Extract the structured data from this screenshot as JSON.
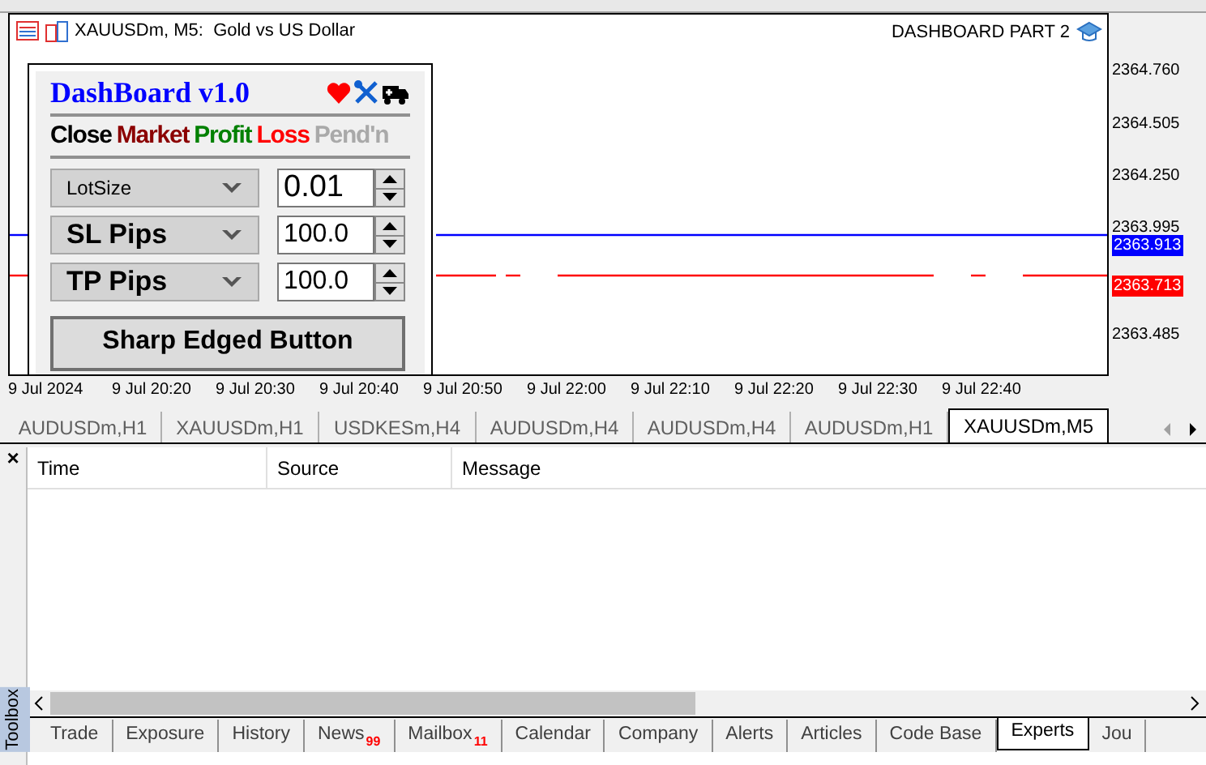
{
  "chart": {
    "title": "XAUUSDm, M5:  Gold vs US Dollar",
    "label": "DASHBOARD PART 2",
    "price_ticks": [
      "2364.760",
      "2364.505",
      "2364.250",
      "2363.995",
      "2363.485"
    ],
    "bid_label": "2363.913",
    "ask_label": "2363.713",
    "time_ticks": [
      "9 Jul 2024",
      "9 Jul 20:20",
      "9 Jul 20:30",
      "9 Jul 20:40",
      "9 Jul 20:50",
      "9 Jul 22:00",
      "9 Jul 22:10",
      "9 Jul 22:20",
      "9 Jul 22:30",
      "9 Jul 22:40"
    ]
  },
  "dashboard": {
    "title": "DashBoard v1.0",
    "tabs": [
      {
        "label": "Close",
        "color": "#000000"
      },
      {
        "label": "Market",
        "color": "#8b0000"
      },
      {
        "label": "Profit",
        "color": "#008000"
      },
      {
        "label": "Loss",
        "color": "#ff0000"
      },
      {
        "label": "Pend'n",
        "color": "#a9a9a9"
      }
    ],
    "rows": [
      {
        "label": "LotSize",
        "value": "0.01",
        "kind": "small"
      },
      {
        "label": "SL Pips",
        "value": "100.0",
        "kind": "large"
      },
      {
        "label": "TP Pips",
        "value": "100.0",
        "kind": "large"
      }
    ],
    "button": "Sharp Edged Button"
  },
  "chart_tabs": [
    {
      "label": "AUDUSDm,H1",
      "selected": false
    },
    {
      "label": "XAUUSDm,H1",
      "selected": false
    },
    {
      "label": "USDKESm,H4",
      "selected": false
    },
    {
      "label": "AUDUSDm,H4",
      "selected": false
    },
    {
      "label": "AUDUSDm,H4",
      "selected": false
    },
    {
      "label": "AUDUSDm,H1",
      "selected": false
    },
    {
      "label": "XAUUSDm,M5",
      "selected": true
    }
  ],
  "toolbox": {
    "title": "Toolbox",
    "close": "×",
    "columns": [
      "Time",
      "Source",
      "Message"
    ],
    "tabs": [
      {
        "label": "Trade",
        "selected": false
      },
      {
        "label": "Exposure",
        "selected": false
      },
      {
        "label": "History",
        "selected": false
      },
      {
        "label": "News",
        "badge": "99",
        "selected": false
      },
      {
        "label": "Mailbox",
        "badge": "11",
        "selected": false
      },
      {
        "label": "Calendar",
        "selected": false
      },
      {
        "label": "Company",
        "selected": false
      },
      {
        "label": "Alerts",
        "selected": false
      },
      {
        "label": "Articles",
        "selected": false
      },
      {
        "label": "Code Base",
        "selected": false
      },
      {
        "label": "Experts",
        "selected": true
      },
      {
        "label": "Jou",
        "selected": false
      }
    ]
  }
}
